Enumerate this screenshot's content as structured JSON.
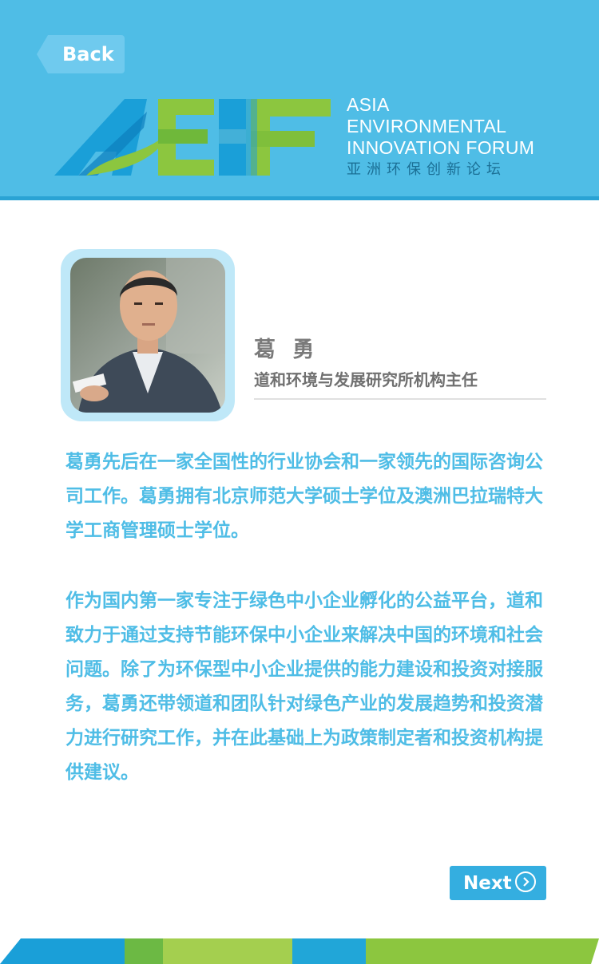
{
  "header": {
    "back_label": "Back",
    "logo": {
      "mark_text": "AEIF",
      "line1": "ASIA",
      "line2": "ENVIRONMENTAL",
      "line3": "INNOVATION FORUM",
      "cn": "亚洲环保创新论坛"
    }
  },
  "profile": {
    "name": "葛 勇",
    "title": "道和环境与发展研究所机构主任"
  },
  "bio": {
    "paragraph1": "葛勇先后在一家全国性的行业协会和一家领先的国际咨询公司工作。葛勇拥有北京师范大学硕士学位及澳洲巴拉瑞特大学工商管理硕士学位。",
    "paragraph2": "作为国内第一家专注于绿色中小企业孵化的公益平台，道和致力于通过支持节能环保中小企业来解决中国的环境和社会问题。除了为环保型中小企业提供的能力建设和投资对接服务，葛勇还带领道和团队针对绿色产业的发展趋势和投资潜力进行研究工作，并在此基础上为政策制定者和投资机构提供建议。"
  },
  "nav": {
    "next_label": "Next"
  },
  "icons": {
    "back": "back-arrow-icon",
    "next": "chevron-right-circle-icon"
  },
  "colors": {
    "header_bg": "#4fbde6",
    "accent_blue": "#34aee0",
    "accent_green": "#8cc63f",
    "text_blue": "#4fbde6",
    "text_gray": "#707070"
  }
}
